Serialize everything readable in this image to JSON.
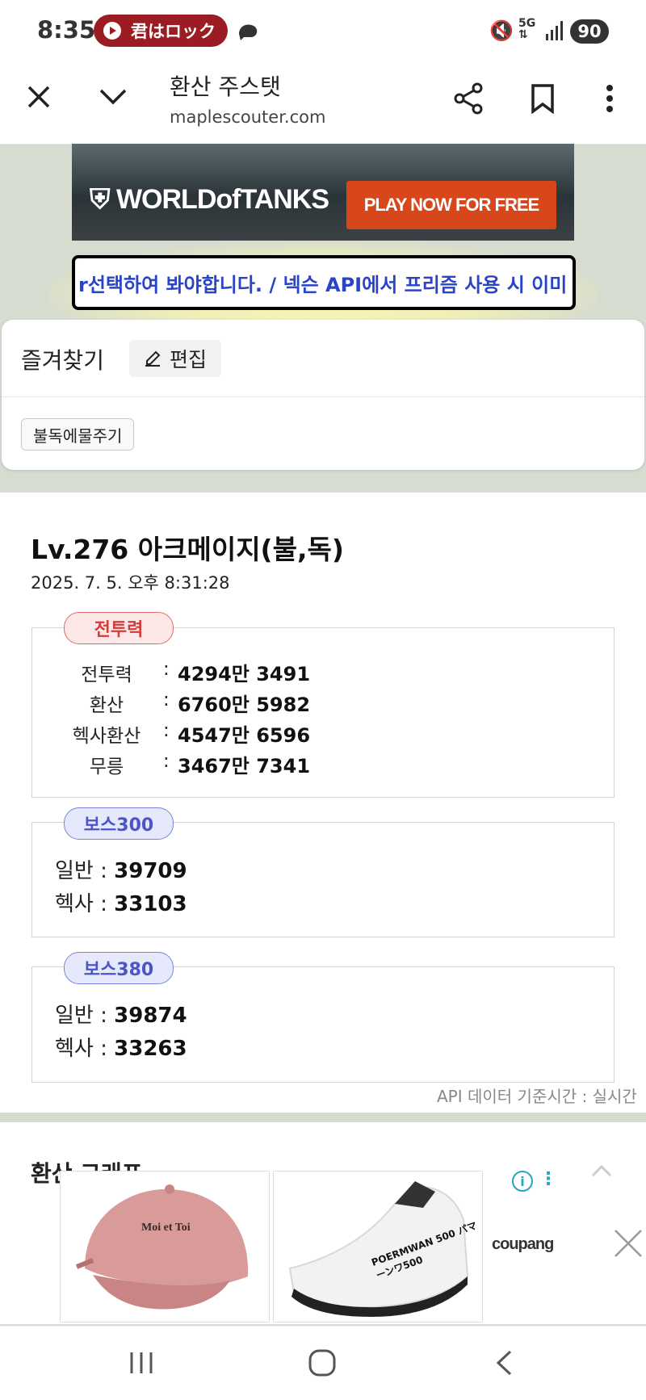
{
  "status_bar": {
    "time": "8:35",
    "music_title": "君はロック",
    "network": "5G",
    "battery": "90"
  },
  "browser": {
    "page_title": "환산 주스탯",
    "url": "maplescouter.com"
  },
  "ad_banner": {
    "logo_text": "WORLDofTANKS",
    "cta_text": "PLAY NOW FOR FREE"
  },
  "ticker": {
    "text": "r선택하여 봐야합니다. / 넥슨 API에서 프리즘 사용 시 이미"
  },
  "favorites": {
    "title": "즐겨찾기",
    "edit_label": "편집",
    "items": [
      "불독에물주기"
    ]
  },
  "character": {
    "title": "Lv.276 아크메이지(불,독)",
    "date": "2025. 7. 5. 오후 8:31:28"
  },
  "total_power": {
    "badge": "전투력",
    "rows": [
      {
        "label": "전투력",
        "value": "4294만 3491"
      },
      {
        "label": "환산",
        "value": "6760만 5982"
      },
      {
        "label": "헥사환산",
        "value": "4547만 6596"
      },
      {
        "label": "무릉",
        "value": "3467만 7341"
      }
    ]
  },
  "boss300": {
    "badge": "보스300",
    "rows": [
      {
        "label": "일반",
        "value": "39709"
      },
      {
        "label": "헥사",
        "value": "33103"
      }
    ]
  },
  "boss380": {
    "badge": "보스380",
    "rows": [
      {
        "label": "일반",
        "value": "39874"
      },
      {
        "label": "헥사",
        "value": "33263"
      }
    ]
  },
  "api_note": "API 데이터 기준시간 : 실시간",
  "graph_section": {
    "title": "환산 그래프"
  },
  "coupang_ad": {
    "logo": "coupang",
    "products": [
      {
        "name": "Moi et Toi",
        "color": "#d99a9a"
      },
      {
        "name": "POERMWAN 500 パマーンワ500",
        "color": "#f4f4f4"
      }
    ]
  },
  "colors": {
    "page_bg": "#d6dccf",
    "ticker_text": "#2a44c8",
    "total_badge": "#d23c3c",
    "boss_badge": "#4a55c6",
    "music_pill": "#9c1c24"
  }
}
